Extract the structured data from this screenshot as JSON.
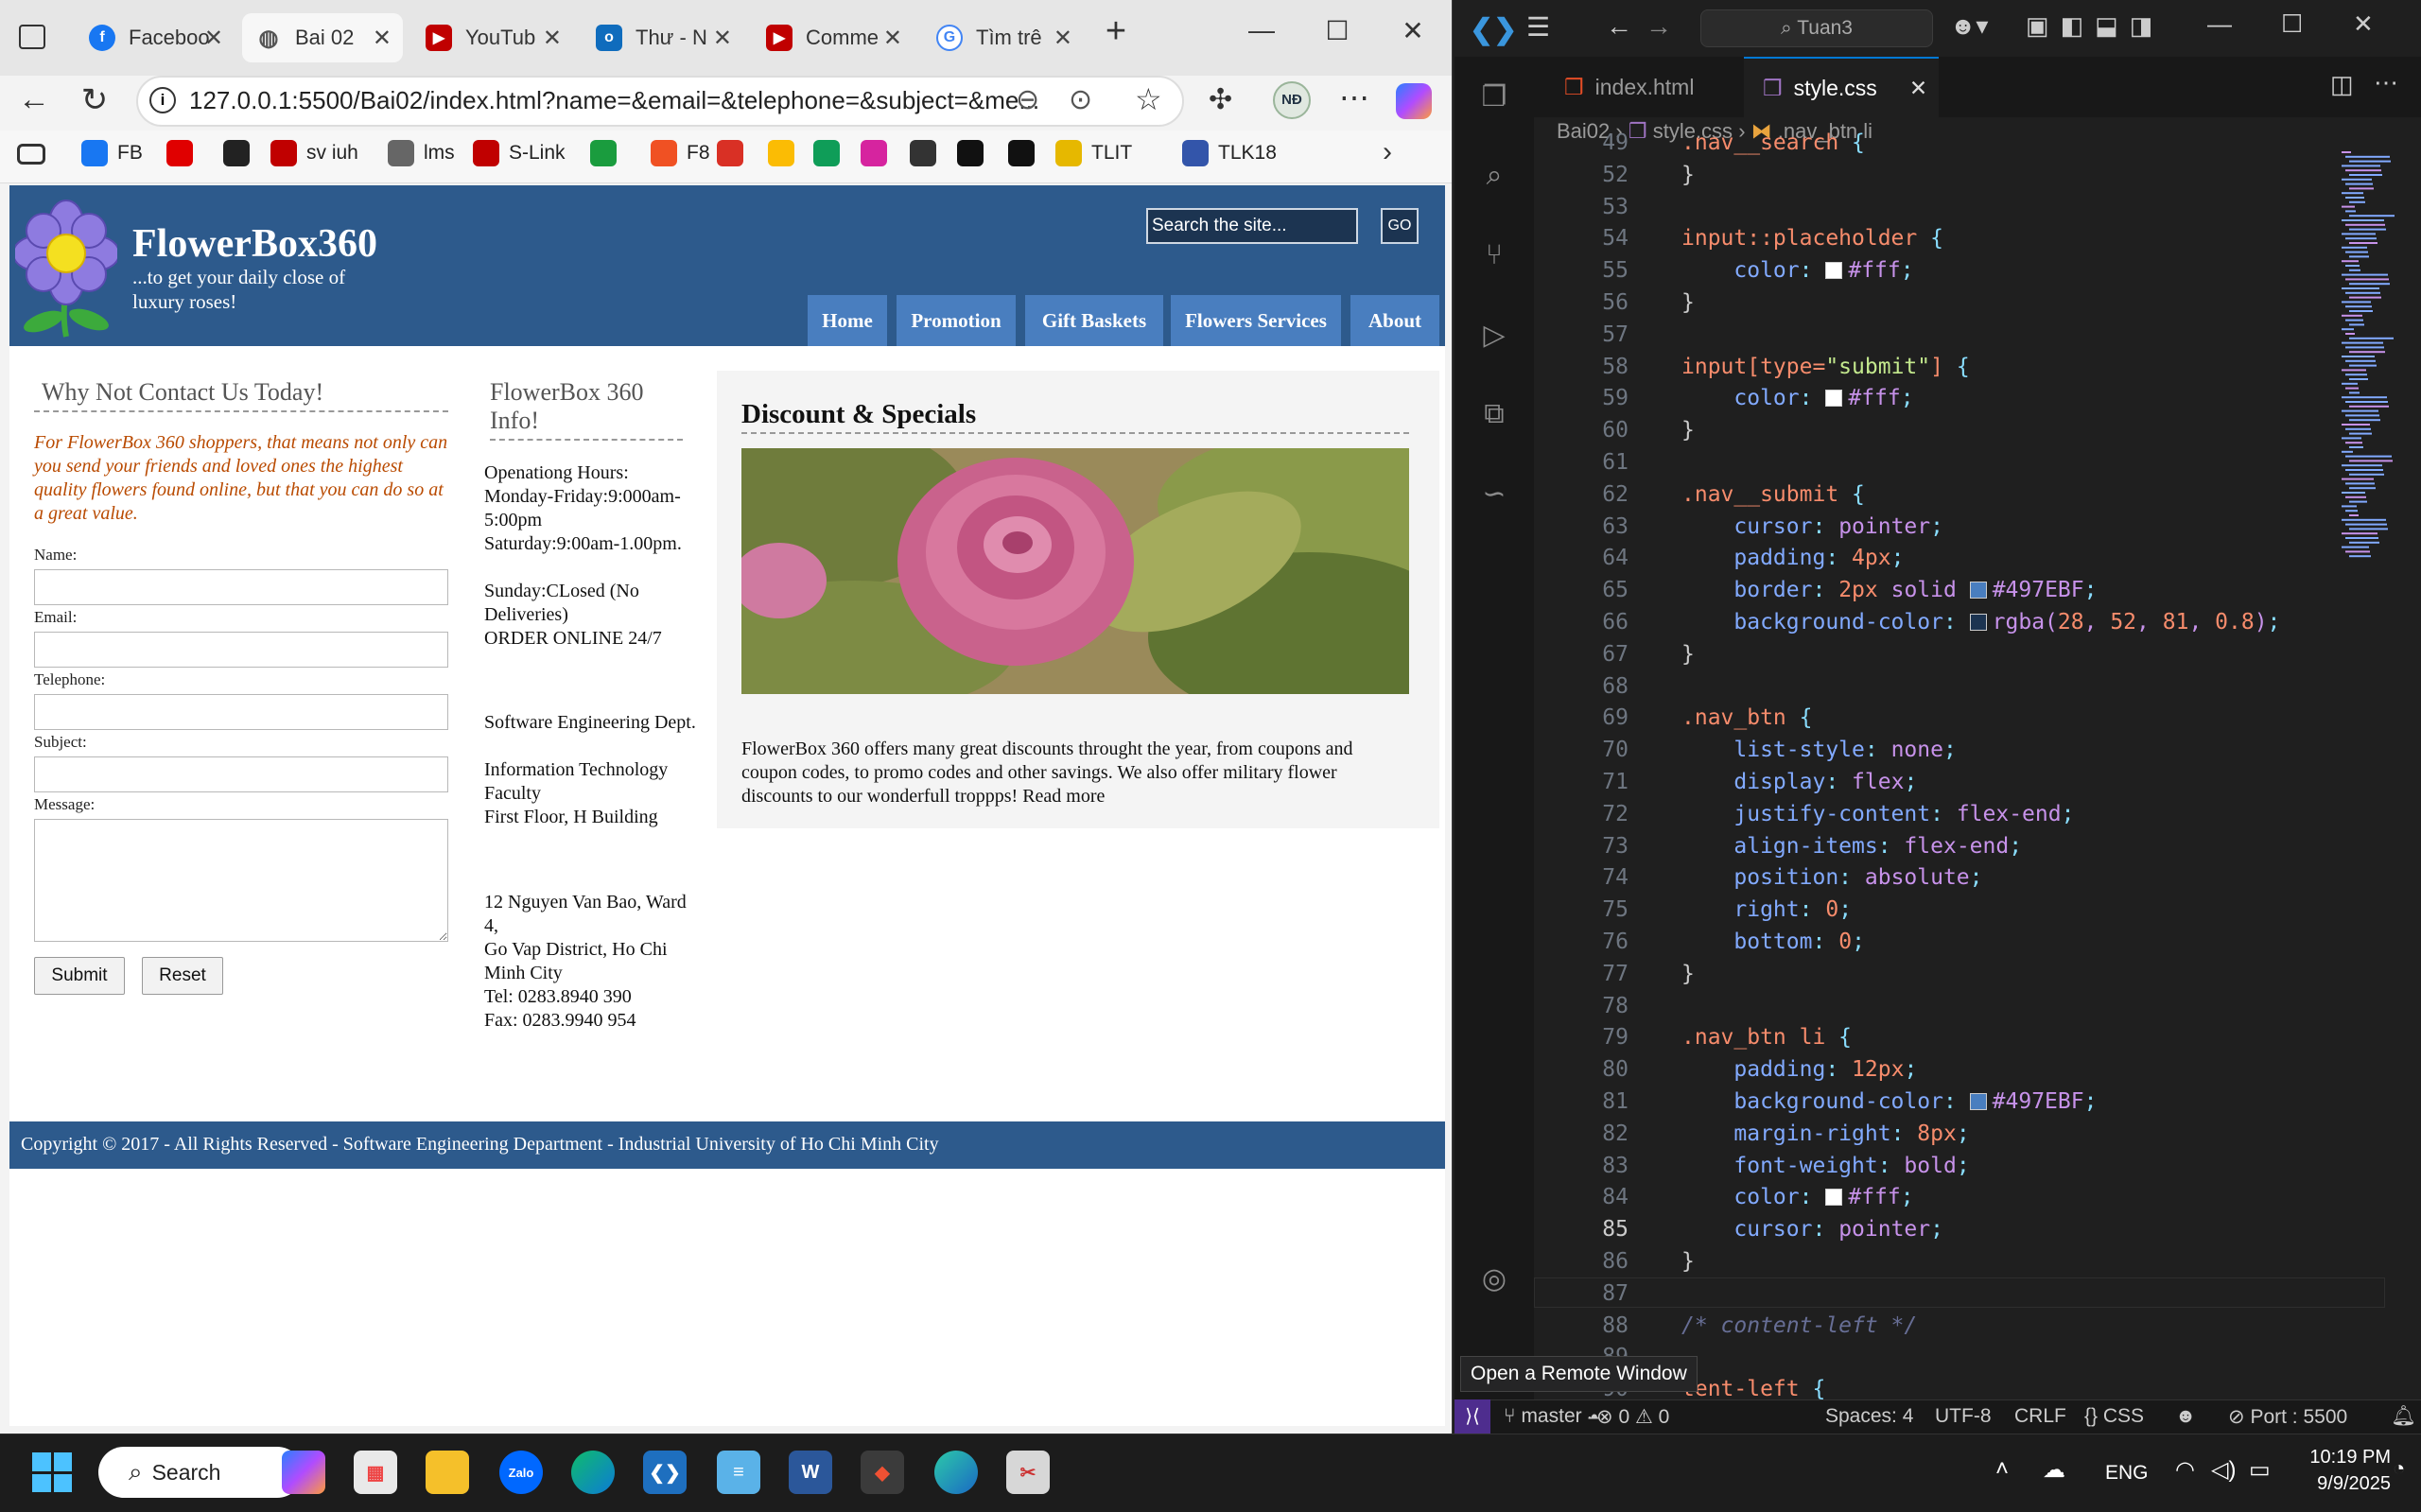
{
  "browser": {
    "tabs": [
      {
        "label": "Faceboo",
        "icon": "facebook-icon",
        "color": "#1877f2"
      },
      {
        "label": "Bai 02",
        "icon": "globe-icon",
        "color": "#555555",
        "active": true
      },
      {
        "label": "YouTub",
        "icon": "youtube-icon",
        "color": "#c00000"
      },
      {
        "label": "Thư - N",
        "icon": "outlook-icon",
        "color": "#0f6cbd"
      },
      {
        "label": "Comme",
        "icon": "youtube-icon",
        "color": "#c00000"
      },
      {
        "label": "Tìm trê",
        "icon": "google-icon",
        "color": "#4285f4"
      }
    ],
    "new_tab": "+",
    "url": "127.0.0.1:5500/Bai02/index.html?name=&email=&telephone=&subject=&me...",
    "profile_initials": "NĐ",
    "bookmarks": [
      {
        "label": "FB",
        "icon": "facebook-icon",
        "color": "#1877f2"
      },
      {
        "label": "",
        "icon": "youtube-icon",
        "color": "#e00000"
      },
      {
        "label": "",
        "icon": "github-icon",
        "color": "#222222"
      },
      {
        "label": "sv iuh",
        "icon": "iuh-icon",
        "color": "#c00000"
      },
      {
        "label": "lms",
        "icon": "lms-icon",
        "color": "#666666"
      },
      {
        "label": "S-Link",
        "icon": "slink-icon",
        "color": "#c00000"
      },
      {
        "label": "",
        "icon": "w-icon",
        "color": "#1a9c3e"
      },
      {
        "label": "F8",
        "icon": "f8-icon",
        "color": "#f05123"
      },
      {
        "label": "",
        "icon": "gmail-icon",
        "color": "#d93025"
      },
      {
        "label": "",
        "icon": "photos-icon",
        "color": "#fbbc04"
      },
      {
        "label": "",
        "icon": "drive-icon",
        "color": "#0f9d58"
      },
      {
        "label": "",
        "icon": "instagram-icon",
        "color": "#d6249f"
      },
      {
        "label": "",
        "icon": "chatgpt-icon",
        "color": "#333333"
      },
      {
        "label": "",
        "icon": "tiktok-icon",
        "color": "#111111"
      },
      {
        "label": "",
        "icon": "terminal-icon",
        "color": "#111111"
      },
      {
        "label": "TLIT",
        "icon": "folder-icon",
        "color": "#e6b800"
      },
      {
        "label": "TLK18",
        "icon": "tlk-icon",
        "color": "#3355aa"
      }
    ]
  },
  "site": {
    "title": "FlowerBox360",
    "tagline": "...to get your daily close of luxury roses!",
    "search_placeholder": "Search the site...",
    "go_label": "GO",
    "nav": [
      "Home",
      "Promotion",
      "Gift Baskets",
      "Flowers Services",
      "About"
    ],
    "contact": {
      "heading": "Why Not Contact Us Today!",
      "intro": "For FlowerBox 360 shoppers, that means not only can you send your friends and loved ones the highest quality flowers found online, but that you can do so at a great value.",
      "labels": [
        "Name:",
        "Email:",
        "Telephone:",
        "Subject:",
        "Message:"
      ],
      "submit": "Submit",
      "reset": "Reset"
    },
    "info": {
      "heading": "FlowerBox 360 Info!",
      "hours": [
        "Openationg Hours:",
        "Monday-Friday:9:000am-5:00pm",
        "Saturday:9:00am-1.00pm.",
        "Sunday:CLosed (No Deliveries)",
        "ORDER ONLINE 24/7"
      ],
      "dept": [
        "Software Engineering Dept.",
        "Information Technology Faculty",
        "First Floor, H Building"
      ],
      "address": [
        "12 Nguyen Van Bao, Ward 4,",
        "Go Vap District, Ho Chi Minh City",
        "Tel: 0283.8940 390",
        "Fax: 0283.9940 954"
      ]
    },
    "specials": {
      "heading": "Discount & Specials",
      "body": "FlowerBox 360 offers many great discounts throught the year, from coupons and coupon codes, to promo codes and other savings. We also offer military flower discounts to our wonderfull troppps! Read more"
    },
    "footer": "Copyright © 2017 - All Rights Reserved - Software Engineering Department - Industrial University of Ho Chi Minh City"
  },
  "vscode": {
    "search_box": "Tuan3",
    "tabs": [
      "index.html",
      "style.css"
    ],
    "breadcrumb": [
      "Bai02",
      "style.css",
      ".nav_btn li"
    ],
    "lines": [
      {
        "n": "49",
        "text": ".nav__search {"
      },
      {
        "n": "52",
        "text": "}"
      },
      {
        "n": "53",
        "text": ""
      },
      {
        "n": "54",
        "text": "input::placeholder {"
      },
      {
        "n": "55",
        "text": "    color: #fff;"
      },
      {
        "n": "56",
        "text": "}"
      },
      {
        "n": "57",
        "text": ""
      },
      {
        "n": "58",
        "text": "input[type=\"submit\"] {"
      },
      {
        "n": "59",
        "text": "    color: #fff;"
      },
      {
        "n": "60",
        "text": "}"
      },
      {
        "n": "61",
        "text": ""
      },
      {
        "n": "62",
        "text": ".nav__submit {"
      },
      {
        "n": "63",
        "text": "    cursor: pointer;"
      },
      {
        "n": "64",
        "text": "    padding: 4px;"
      },
      {
        "n": "65",
        "text": "    border: 2px solid #497EBF;"
      },
      {
        "n": "66",
        "text": "    background-color: rgba(28, 52, 81, 0.8);"
      },
      {
        "n": "67",
        "text": "}"
      },
      {
        "n": "68",
        "text": ""
      },
      {
        "n": "69",
        "text": ".nav_btn {"
      },
      {
        "n": "70",
        "text": "    list-style: none;"
      },
      {
        "n": "71",
        "text": "    display: flex;"
      },
      {
        "n": "72",
        "text": "    justify-content: flex-end;"
      },
      {
        "n": "73",
        "text": "    align-items: flex-end;"
      },
      {
        "n": "74",
        "text": "    position: absolute;"
      },
      {
        "n": "75",
        "text": "    right: 0;"
      },
      {
        "n": "76",
        "text": "    bottom: 0;"
      },
      {
        "n": "77",
        "text": "}"
      },
      {
        "n": "78",
        "text": ""
      },
      {
        "n": "79",
        "text": ".nav_btn li {"
      },
      {
        "n": "80",
        "text": "    padding: 12px;"
      },
      {
        "n": "81",
        "text": "    background-color: #497EBF;"
      },
      {
        "n": "82",
        "text": "    margin-right: 8px;"
      },
      {
        "n": "83",
        "text": "    font-weight: bold;"
      },
      {
        "n": "84",
        "text": "    color: #fff;"
      },
      {
        "n": "85",
        "text": "    cursor: pointer;"
      },
      {
        "n": "86",
        "text": "}"
      },
      {
        "n": "87",
        "text": ""
      },
      {
        "n": "88",
        "text": "/* content-left */"
      },
      {
        "n": "89",
        "text": ""
      },
      {
        "n": "90",
        "text": "tent-left {"
      }
    ],
    "tooltip": "Open a Remote Window",
    "status": {
      "branch": "master",
      "errors": "0",
      "warnings": "0",
      "spaces": "Spaces: 4",
      "encoding": "UTF-8",
      "eol": "CRLF",
      "language": "CSS",
      "port": "Port : 5500"
    }
  },
  "taskbar": {
    "search": "Search",
    "lang": "ENG",
    "time": "10:19 PM",
    "date": "9/9/2025"
  },
  "colors": {
    "site_header": "#2d5a8c",
    "nav_button": "#497ebf",
    "intro_text": "#b94a00",
    "vscode_accent": "#0078d4"
  }
}
